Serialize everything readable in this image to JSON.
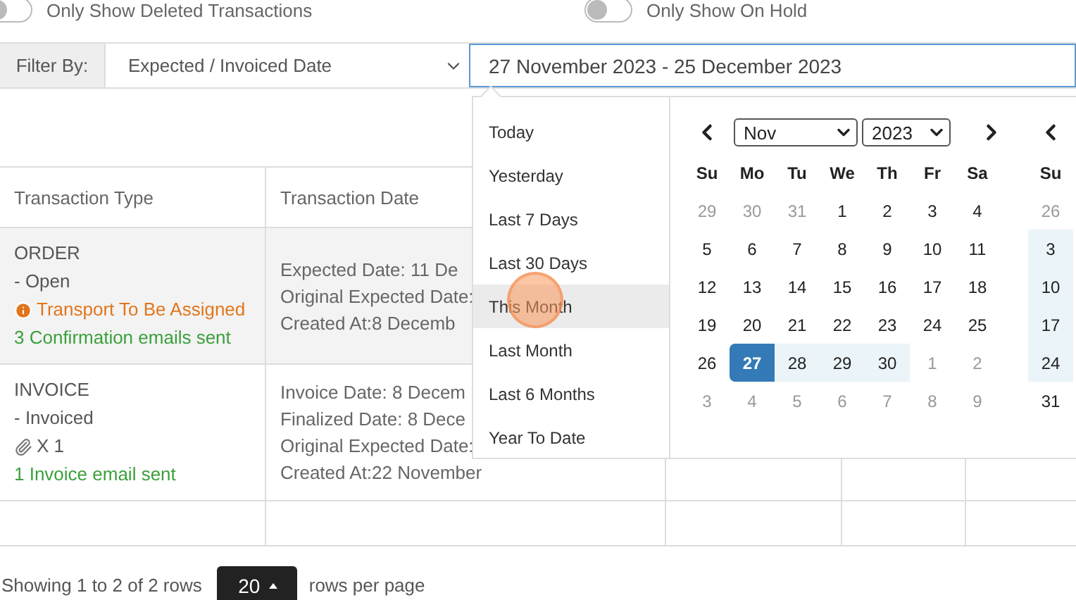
{
  "toggles": [
    {
      "label": "Only Show Deleted Transactions",
      "on": false
    },
    {
      "label": "Only Show On Hold",
      "on": false
    }
  ],
  "filter": {
    "label": "Filter By:",
    "field": "Expected / Invoiced Date",
    "date_range": "27 November 2023 - 25 December 2023"
  },
  "date_picker": {
    "presets": [
      {
        "label": "Today",
        "selected": false
      },
      {
        "label": "Yesterday",
        "selected": false
      },
      {
        "label": "Last 7 Days",
        "selected": false
      },
      {
        "label": "Last 30 Days",
        "selected": false
      },
      {
        "label": "This Month",
        "selected": true
      },
      {
        "label": "Last Month",
        "selected": false
      },
      {
        "label": "Last 6 Months",
        "selected": false
      },
      {
        "label": "Year To Date",
        "selected": false
      }
    ],
    "calendars": [
      {
        "month": "Nov",
        "year": "2023",
        "weekdays": [
          "Su",
          "Mo",
          "Tu",
          "We",
          "Th",
          "Fr",
          "Sa"
        ],
        "weeks": [
          [
            {
              "day": "29",
              "muted": true,
              "start": false,
              "in_range": false
            },
            {
              "day": "30",
              "muted": true,
              "start": false,
              "in_range": false
            },
            {
              "day": "31",
              "muted": true,
              "start": false,
              "in_range": false
            },
            {
              "day": "1",
              "muted": false,
              "start": false,
              "in_range": false
            },
            {
              "day": "2",
              "muted": false,
              "start": false,
              "in_range": false
            },
            {
              "day": "3",
              "muted": false,
              "start": false,
              "in_range": false
            },
            {
              "day": "4",
              "muted": false,
              "start": false,
              "in_range": false
            }
          ],
          [
            {
              "day": "5",
              "muted": false,
              "start": false,
              "in_range": false
            },
            {
              "day": "6",
              "muted": false,
              "start": false,
              "in_range": false
            },
            {
              "day": "7",
              "muted": false,
              "start": false,
              "in_range": false
            },
            {
              "day": "8",
              "muted": false,
              "start": false,
              "in_range": false
            },
            {
              "day": "9",
              "muted": false,
              "start": false,
              "in_range": false
            },
            {
              "day": "10",
              "muted": false,
              "start": false,
              "in_range": false
            },
            {
              "day": "11",
              "muted": false,
              "start": false,
              "in_range": false
            }
          ],
          [
            {
              "day": "12",
              "muted": false,
              "start": false,
              "in_range": false
            },
            {
              "day": "13",
              "muted": false,
              "start": false,
              "in_range": false
            },
            {
              "day": "14",
              "muted": false,
              "start": false,
              "in_range": false
            },
            {
              "day": "15",
              "muted": false,
              "start": false,
              "in_range": false
            },
            {
              "day": "16",
              "muted": false,
              "start": false,
              "in_range": false
            },
            {
              "day": "17",
              "muted": false,
              "start": false,
              "in_range": false
            },
            {
              "day": "18",
              "muted": false,
              "start": false,
              "in_range": false
            }
          ],
          [
            {
              "day": "19",
              "muted": false,
              "start": false,
              "in_range": false
            },
            {
              "day": "20",
              "muted": false,
              "start": false,
              "in_range": false
            },
            {
              "day": "21",
              "muted": false,
              "start": false,
              "in_range": false
            },
            {
              "day": "22",
              "muted": false,
              "start": false,
              "in_range": false
            },
            {
              "day": "23",
              "muted": false,
              "start": false,
              "in_range": false
            },
            {
              "day": "24",
              "muted": false,
              "start": false,
              "in_range": false
            },
            {
              "day": "25",
              "muted": false,
              "start": false,
              "in_range": false
            }
          ],
          [
            {
              "day": "26",
              "muted": false,
              "start": false,
              "in_range": false
            },
            {
              "day": "27",
              "muted": false,
              "start": true,
              "in_range": true
            },
            {
              "day": "28",
              "muted": false,
              "start": false,
              "in_range": true
            },
            {
              "day": "29",
              "muted": false,
              "start": false,
              "in_range": true
            },
            {
              "day": "30",
              "muted": false,
              "start": false,
              "in_range": true
            },
            {
              "day": "1",
              "muted": true,
              "start": false,
              "in_range": false
            },
            {
              "day": "2",
              "muted": true,
              "start": false,
              "in_range": false
            }
          ],
          [
            {
              "day": "3",
              "muted": true,
              "start": false,
              "in_range": false
            },
            {
              "day": "4",
              "muted": true,
              "start": false,
              "in_range": false
            },
            {
              "day": "5",
              "muted": true,
              "start": false,
              "in_range": false
            },
            {
              "day": "6",
              "muted": true,
              "start": false,
              "in_range": false
            },
            {
              "day": "7",
              "muted": true,
              "start": false,
              "in_range": false
            },
            {
              "day": "8",
              "muted": true,
              "start": false,
              "in_range": false
            },
            {
              "day": "9",
              "muted": true,
              "start": false,
              "in_range": false
            }
          ]
        ]
      },
      {
        "weekdays": [
          "Su"
        ],
        "weeks": [
          [
            {
              "day": "26",
              "muted": true,
              "start": false,
              "in_range": false
            }
          ],
          [
            {
              "day": "3",
              "muted": false,
              "start": false,
              "in_range": true
            }
          ],
          [
            {
              "day": "10",
              "muted": false,
              "start": false,
              "in_range": true
            }
          ],
          [
            {
              "day": "17",
              "muted": false,
              "start": false,
              "in_range": true
            }
          ],
          [
            {
              "day": "24",
              "muted": false,
              "start": false,
              "in_range": true
            }
          ],
          [
            {
              "day": "31",
              "muted": false,
              "start": false,
              "in_range": false
            }
          ]
        ]
      }
    ]
  },
  "table": {
    "columns": [
      "Transaction Type",
      "Transaction Date"
    ],
    "rows": [
      {
        "highlighted": true,
        "type_lines": [
          {
            "kind": "plain",
            "text": "ORDER"
          },
          {
            "kind": "plain",
            "text": "- Open"
          },
          {
            "kind": "warning",
            "text": "Transport To Be Assigned"
          },
          {
            "kind": "success",
            "text": "3 Confirmation emails sent"
          }
        ],
        "date_lines": [
          "Expected Date: 11 De",
          "Original Expected Date:",
          "Created At:8 Decemb"
        ]
      },
      {
        "highlighted": false,
        "type_lines": [
          {
            "kind": "plain",
            "text": "INVOICE"
          },
          {
            "kind": "plain",
            "text": "- Invoiced"
          },
          {
            "kind": "attachment",
            "text": "X 1"
          },
          {
            "kind": "success",
            "text": "1 Invoice email sent"
          }
        ],
        "date_lines": [
          "Invoice Date: 8 Decem",
          "Finalized Date: 8 Dece",
          "Original Expected Date:",
          "Created At:22 November"
        ]
      }
    ]
  },
  "pagination": {
    "summary": "Showing 1 to 2 of 2 rows",
    "page_size": "20",
    "suffix": "rows per page"
  }
}
